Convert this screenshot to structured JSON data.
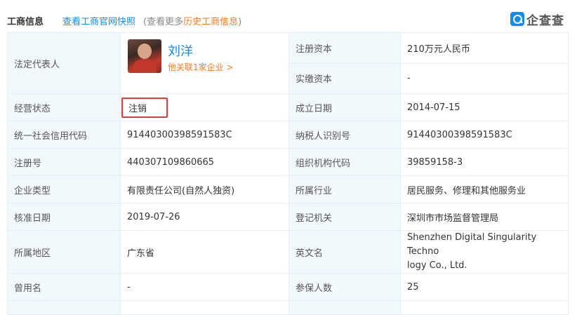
{
  "header": {
    "title": "工商信息",
    "snapshot_link": "查看工商官网快照",
    "history_prefix": "(查看更多",
    "history_link": "历史工商信息",
    "history_suffix": ")",
    "brand": "企查查"
  },
  "legal_rep": {
    "label": "法定代表人",
    "name": "刘洋",
    "related": "他关联1家企业 >"
  },
  "rows": {
    "reg_capital": {
      "label": "注册资本",
      "value": "210万元人民币"
    },
    "paid_capital": {
      "label": "实缴资本",
      "value": "-"
    },
    "status": {
      "label": "经营状态",
      "value": "注销"
    },
    "est_date": {
      "label": "成立日期",
      "value": "2014-07-15"
    },
    "credit_code": {
      "label": "统一社会信用代码",
      "value": "91440300398591583C"
    },
    "taxpayer_id": {
      "label": "纳税人识别号",
      "value": "91440300398591583C"
    },
    "reg_no": {
      "label": "注册号",
      "value": "440307109860665"
    },
    "org_code": {
      "label": "组织机构代码",
      "value": "39859158-3"
    },
    "company_type": {
      "label": "企业类型",
      "value": "有限责任公司(自然人独资)"
    },
    "industry": {
      "label": "所属行业",
      "value": "居民服务、修理和其他服务业"
    },
    "approval_date": {
      "label": "核准日期",
      "value": "2019-07-26"
    },
    "authority": {
      "label": "登记机关",
      "value": "深圳市市场监督管理局"
    },
    "region": {
      "label": "所属地区",
      "value": "广东省"
    },
    "english_name": {
      "label": "英文名",
      "value_line1": "Shenzhen Digital Singularity Techno",
      "value_line2": "logy Co., Ltd."
    },
    "former_name": {
      "label": "曾用名",
      "value": "-"
    },
    "insured": {
      "label": "参保人数",
      "value": "25"
    }
  },
  "colors": {
    "link_blue": "#128bed",
    "accent_orange": "#fd7a1e",
    "label_bg": "#f2f9fc",
    "border": "#e4eef6",
    "highlight_red": "#e23b3b"
  }
}
